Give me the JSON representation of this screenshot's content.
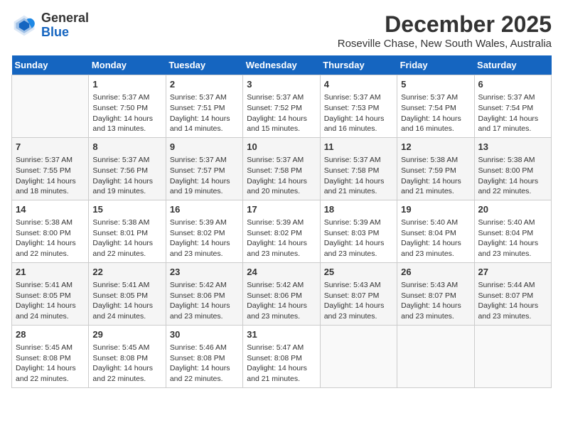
{
  "logo": {
    "general": "General",
    "blue": "Blue"
  },
  "title": "December 2025",
  "subtitle": "Roseville Chase, New South Wales, Australia",
  "days_header": [
    "Sunday",
    "Monday",
    "Tuesday",
    "Wednesday",
    "Thursday",
    "Friday",
    "Saturday"
  ],
  "weeks": [
    [
      {
        "day": "",
        "info": ""
      },
      {
        "day": "1",
        "info": "Sunrise: 5:37 AM\nSunset: 7:50 PM\nDaylight: 14 hours\nand 13 minutes."
      },
      {
        "day": "2",
        "info": "Sunrise: 5:37 AM\nSunset: 7:51 PM\nDaylight: 14 hours\nand 14 minutes."
      },
      {
        "day": "3",
        "info": "Sunrise: 5:37 AM\nSunset: 7:52 PM\nDaylight: 14 hours\nand 15 minutes."
      },
      {
        "day": "4",
        "info": "Sunrise: 5:37 AM\nSunset: 7:53 PM\nDaylight: 14 hours\nand 16 minutes."
      },
      {
        "day": "5",
        "info": "Sunrise: 5:37 AM\nSunset: 7:54 PM\nDaylight: 14 hours\nand 16 minutes."
      },
      {
        "day": "6",
        "info": "Sunrise: 5:37 AM\nSunset: 7:54 PM\nDaylight: 14 hours\nand 17 minutes."
      }
    ],
    [
      {
        "day": "7",
        "info": "Sunrise: 5:37 AM\nSunset: 7:55 PM\nDaylight: 14 hours\nand 18 minutes."
      },
      {
        "day": "8",
        "info": "Sunrise: 5:37 AM\nSunset: 7:56 PM\nDaylight: 14 hours\nand 19 minutes."
      },
      {
        "day": "9",
        "info": "Sunrise: 5:37 AM\nSunset: 7:57 PM\nDaylight: 14 hours\nand 19 minutes."
      },
      {
        "day": "10",
        "info": "Sunrise: 5:37 AM\nSunset: 7:58 PM\nDaylight: 14 hours\nand 20 minutes."
      },
      {
        "day": "11",
        "info": "Sunrise: 5:37 AM\nSunset: 7:58 PM\nDaylight: 14 hours\nand 21 minutes."
      },
      {
        "day": "12",
        "info": "Sunrise: 5:38 AM\nSunset: 7:59 PM\nDaylight: 14 hours\nand 21 minutes."
      },
      {
        "day": "13",
        "info": "Sunrise: 5:38 AM\nSunset: 8:00 PM\nDaylight: 14 hours\nand 22 minutes."
      }
    ],
    [
      {
        "day": "14",
        "info": "Sunrise: 5:38 AM\nSunset: 8:00 PM\nDaylight: 14 hours\nand 22 minutes."
      },
      {
        "day": "15",
        "info": "Sunrise: 5:38 AM\nSunset: 8:01 PM\nDaylight: 14 hours\nand 22 minutes."
      },
      {
        "day": "16",
        "info": "Sunrise: 5:39 AM\nSunset: 8:02 PM\nDaylight: 14 hours\nand 23 minutes."
      },
      {
        "day": "17",
        "info": "Sunrise: 5:39 AM\nSunset: 8:02 PM\nDaylight: 14 hours\nand 23 minutes."
      },
      {
        "day": "18",
        "info": "Sunrise: 5:39 AM\nSunset: 8:03 PM\nDaylight: 14 hours\nand 23 minutes."
      },
      {
        "day": "19",
        "info": "Sunrise: 5:40 AM\nSunset: 8:04 PM\nDaylight: 14 hours\nand 23 minutes."
      },
      {
        "day": "20",
        "info": "Sunrise: 5:40 AM\nSunset: 8:04 PM\nDaylight: 14 hours\nand 23 minutes."
      }
    ],
    [
      {
        "day": "21",
        "info": "Sunrise: 5:41 AM\nSunset: 8:05 PM\nDaylight: 14 hours\nand 24 minutes."
      },
      {
        "day": "22",
        "info": "Sunrise: 5:41 AM\nSunset: 8:05 PM\nDaylight: 14 hours\nand 24 minutes."
      },
      {
        "day": "23",
        "info": "Sunrise: 5:42 AM\nSunset: 8:06 PM\nDaylight: 14 hours\nand 23 minutes."
      },
      {
        "day": "24",
        "info": "Sunrise: 5:42 AM\nSunset: 8:06 PM\nDaylight: 14 hours\nand 23 minutes."
      },
      {
        "day": "25",
        "info": "Sunrise: 5:43 AM\nSunset: 8:07 PM\nDaylight: 14 hours\nand 23 minutes."
      },
      {
        "day": "26",
        "info": "Sunrise: 5:43 AM\nSunset: 8:07 PM\nDaylight: 14 hours\nand 23 minutes."
      },
      {
        "day": "27",
        "info": "Sunrise: 5:44 AM\nSunset: 8:07 PM\nDaylight: 14 hours\nand 23 minutes."
      }
    ],
    [
      {
        "day": "28",
        "info": "Sunrise: 5:45 AM\nSunset: 8:08 PM\nDaylight: 14 hours\nand 22 minutes."
      },
      {
        "day": "29",
        "info": "Sunrise: 5:45 AM\nSunset: 8:08 PM\nDaylight: 14 hours\nand 22 minutes."
      },
      {
        "day": "30",
        "info": "Sunrise: 5:46 AM\nSunset: 8:08 PM\nDaylight: 14 hours\nand 22 minutes."
      },
      {
        "day": "31",
        "info": "Sunrise: 5:47 AM\nSunset: 8:08 PM\nDaylight: 14 hours\nand 21 minutes."
      },
      {
        "day": "",
        "info": ""
      },
      {
        "day": "",
        "info": ""
      },
      {
        "day": "",
        "info": ""
      }
    ]
  ]
}
